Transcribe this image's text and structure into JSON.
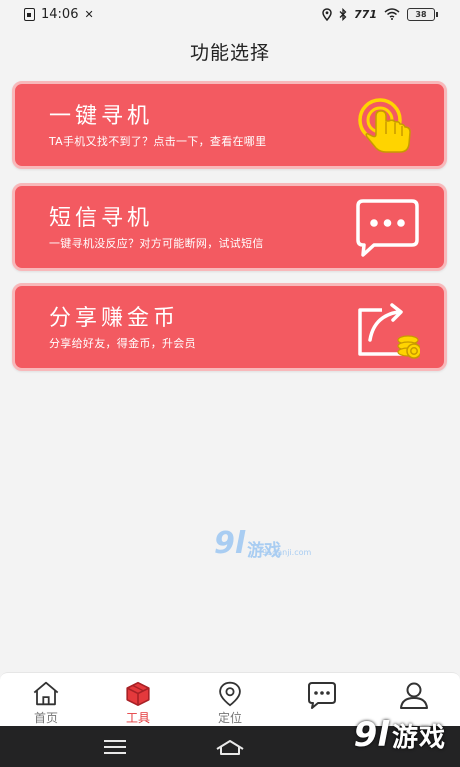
{
  "status_bar": {
    "time": "14:06",
    "network": "771",
    "battery": "38"
  },
  "page": {
    "title": "功能选择"
  },
  "cards": [
    {
      "title": "一键寻机",
      "subtitle": "TA手机又找不到了？点击一下，查看在哪里",
      "icon": "tap-hand-icon"
    },
    {
      "title": "短信寻机",
      "subtitle": "一键寻机没反应？对方可能断网，试试短信",
      "icon": "message-icon"
    },
    {
      "title": "分享赚金币",
      "subtitle": "分享给好友，得金币，升会员",
      "icon": "share-coins-icon"
    }
  ],
  "tabbar": {
    "tabs": [
      {
        "label": "首页",
        "icon": "home-icon",
        "active": false
      },
      {
        "label": "工具",
        "icon": "toolbox-icon",
        "active": true
      },
      {
        "label": "定位",
        "icon": "location-icon",
        "active": false
      },
      {
        "label": "",
        "icon": "chat-icon",
        "active": false
      },
      {
        "label": "",
        "icon": "user-icon",
        "active": false
      }
    ]
  },
  "watermark": {
    "logo_number": "9l",
    "logo_text": "游戏",
    "url": "91danji.com"
  },
  "colors": {
    "card_bg": "#f35a61",
    "card_border": "#f8b8ba",
    "icon_yellow": "#ffd400",
    "active_tab": "#e4393c",
    "nav_bg": "#232324"
  }
}
